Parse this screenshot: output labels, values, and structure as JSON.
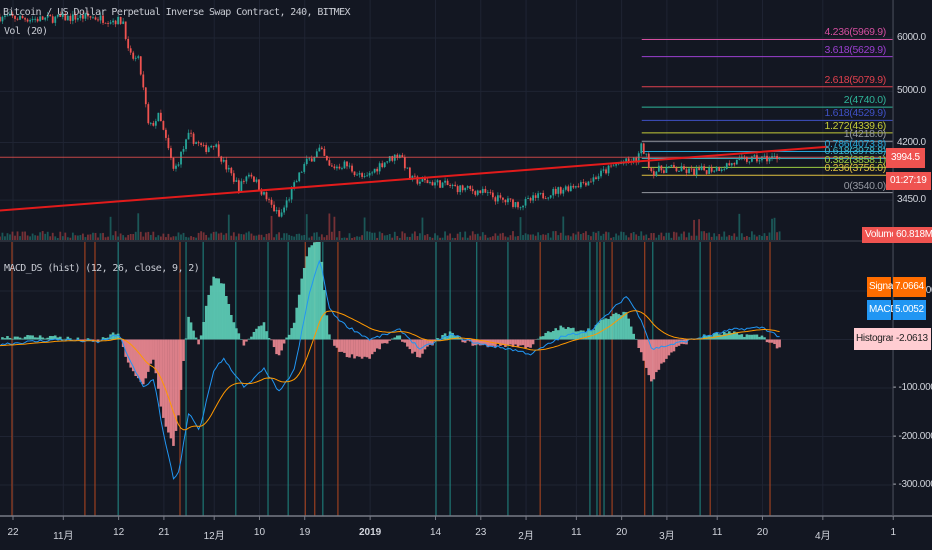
{
  "header": {
    "symbol_title": "Bitcoin / US Dollar Perpetual Inverse Swap Contract, 240, BITMEX",
    "volume_study": "Vol (20)",
    "macd_study": "MACD_DS (hist) (12, 26, close, 9, 2)"
  },
  "price_axis": {
    "ticks": [
      {
        "label": "6000.0",
        "value": 6000
      },
      {
        "label": "5000.0",
        "value": 5000
      },
      {
        "label": "4200.0",
        "value": 4200
      },
      {
        "label": "3450.0",
        "value": 3450
      }
    ],
    "last_price": "3994.5",
    "last_price_value": 3994.5,
    "countdown": "01:27:19",
    "volume_label": "Volume",
    "volume_value": "60.818M"
  },
  "macd_axis": {
    "ticks": [
      {
        "label": "100.0000",
        "value": 100
      },
      {
        "label": "0.0000",
        "value": 0
      },
      {
        "label": "-100.0000",
        "value": -100
      },
      {
        "label": "-200.0000",
        "value": -200
      },
      {
        "label": "-300.0000",
        "value": -300
      }
    ],
    "signal_label": "Signal",
    "signal_value": "7.0664",
    "macd_label": "MACD",
    "macd_value": "5.0052",
    "histogram_label": "Histogram",
    "histogram_value": "-2.0613"
  },
  "colors": {
    "background": "#131722",
    "grid": "#1f2433",
    "up": "#26a69a",
    "down": "#ef5350",
    "trendline": "#e21b1b",
    "macd_line": "#2196f3",
    "signal_line": "#ff9800",
    "hist_pos": "#5fd3bb",
    "hist_neg": "#f28b95",
    "signal_tag": "#ff6d00",
    "macd_tag": "#2196f3",
    "hist_tag": "#ffcdd2",
    "marker_teal": "#1f8a84",
    "marker_orange": "#b5471f"
  },
  "chart_data": {
    "type": "candlestick",
    "title": "Bitcoin / US Dollar Perpetual Inverse Swap Contract, 240, BITMEX",
    "x_unit": "days since 2018-10-22",
    "x_ticks": [
      {
        "label": "22",
        "day": 0
      },
      {
        "label": "11月",
        "day": 10
      },
      {
        "label": "12",
        "day": 21
      },
      {
        "label": "21",
        "day": 30
      },
      {
        "label": "12月",
        "day": 40
      },
      {
        "label": "10",
        "day": 49
      },
      {
        "label": "19",
        "day": 58
      },
      {
        "label": "2019",
        "day": 71
      },
      {
        "label": "14",
        "day": 84
      },
      {
        "label": "23",
        "day": 93
      },
      {
        "label": "2月",
        "day": 102
      },
      {
        "label": "11",
        "day": 112
      },
      {
        "label": "20",
        "day": 121
      },
      {
        "label": "3月",
        "day": 130
      },
      {
        "label": "11",
        "day": 140
      },
      {
        "label": "20",
        "day": 149
      },
      {
        "label": "4月",
        "day": 161
      },
      {
        "label": "1",
        "day": 175
      }
    ],
    "price_scale": "log",
    "price_close_keypoints": [
      [
        -3,
        6450
      ],
      [
        5,
        6400
      ],
      [
        15,
        6450
      ],
      [
        22,
        6350
      ],
      [
        23,
        5650
      ],
      [
        25,
        5550
      ],
      [
        27,
        4400
      ],
      [
        29,
        4600
      ],
      [
        32,
        3800
      ],
      [
        35,
        4300
      ],
      [
        38,
        4100
      ],
      [
        40,
        4200
      ],
      [
        42,
        3900
      ],
      [
        45,
        3600
      ],
      [
        47,
        3800
      ],
      [
        50,
        3500
      ],
      [
        53,
        3250
      ],
      [
        55,
        3500
      ],
      [
        58,
        3900
      ],
      [
        61,
        4100
      ],
      [
        63,
        3850
      ],
      [
        66,
        3900
      ],
      [
        70,
        3700
      ],
      [
        73,
        3900
      ],
      [
        77,
        4050
      ],
      [
        79,
        3700
      ],
      [
        85,
        3650
      ],
      [
        88,
        3600
      ],
      [
        93,
        3550
      ],
      [
        97,
        3450
      ],
      [
        101,
        3400
      ],
      [
        105,
        3500
      ],
      [
        110,
        3600
      ],
      [
        115,
        3700
      ],
      [
        120,
        3900
      ],
      [
        124,
        3950
      ],
      [
        125,
        4150
      ],
      [
        127,
        3800
      ],
      [
        130,
        3850
      ],
      [
        135,
        3800
      ],
      [
        140,
        3850
      ],
      [
        145,
        3950
      ],
      [
        150,
        3980
      ],
      [
        152.5,
        3994.5
      ]
    ],
    "trendline": {
      "from": [
        -2.6,
        3330
      ],
      "to": [
        162,
        4140
      ]
    },
    "fibonacci": [
      {
        "ratio": "4.236",
        "price": 5969.9,
        "label": "4.236(5969.9)",
        "color": "#d54fa0"
      },
      {
        "ratio": "3.618",
        "price": 5629.9,
        "label": "3.618(5629.9)",
        "color": "#9c3fd0"
      },
      {
        "ratio": "2.618",
        "price": 5079.9,
        "label": "2.618(5079.9)",
        "color": "#e0404e"
      },
      {
        "ratio": "2",
        "price": 4740.0,
        "label": "2(4740.0)",
        "color": "#2fb59a"
      },
      {
        "ratio": "1.618",
        "price": 4529.9,
        "label": "1.618(4529.9)",
        "color": "#3f51c5"
      },
      {
        "ratio": "1.272",
        "price": 4339.6,
        "label": "1.272(4339.6)",
        "color": "#c5cc3a"
      },
      {
        "ratio": "1",
        "price": 4218.0,
        "label": "1(4218.0)",
        "color": "#9598a1"
      },
      {
        "ratio": "0.786",
        "price": 4073.8,
        "label": "0.786(4073.8)",
        "color": "#26a6d6"
      },
      {
        "ratio": "0.618",
        "price": 3978.8,
        "label": "0.618(3978.8)",
        "color": "#3fb8c8"
      },
      {
        "ratio": "0.382",
        "price": 3858.1,
        "label": "0.382(3858.1)",
        "color": "#9ccc40"
      },
      {
        "ratio": "0.236",
        "price": 3756.0,
        "label": "0.236(3756.0)",
        "color": "#e0c040"
      },
      {
        "ratio": "0",
        "price": 3540.0,
        "label": "0(3540.0)",
        "color": "#9598a1"
      }
    ],
    "fib_start_day": 125,
    "macd_keypoints": [
      [
        -3,
        -10
      ],
      [
        9,
        0
      ],
      [
        17,
        -5
      ],
      [
        21,
        10
      ],
      [
        24,
        -60
      ],
      [
        26,
        -100
      ],
      [
        28,
        -80
      ],
      [
        30,
        -200
      ],
      [
        32,
        -290
      ],
      [
        33,
        -270
      ],
      [
        35,
        -150
      ],
      [
        37,
        -190
      ],
      [
        40,
        -60
      ],
      [
        42,
        -40
      ],
      [
        46,
        -100
      ],
      [
        50,
        -60
      ],
      [
        53,
        -110
      ],
      [
        56,
        -60
      ],
      [
        59,
        100
      ],
      [
        61,
        165
      ],
      [
        63,
        60
      ],
      [
        66,
        30
      ],
      [
        71,
        0
      ],
      [
        77,
        20
      ],
      [
        81,
        -20
      ],
      [
        87,
        10
      ],
      [
        93,
        -10
      ],
      [
        99,
        -20
      ],
      [
        103,
        -30
      ],
      [
        109,
        5
      ],
      [
        115,
        20
      ],
      [
        119,
        60
      ],
      [
        122,
        90
      ],
      [
        125,
        40
      ],
      [
        127,
        -20
      ],
      [
        131,
        -10
      ],
      [
        137,
        5
      ],
      [
        143,
        20
      ],
      [
        149,
        25
      ],
      [
        152.5,
        5
      ]
    ],
    "signal_period": 9,
    "markers_teal_days": [
      20.9,
      34.4,
      37.8,
      44.3,
      50.7,
      54.7,
      61.6,
      84.1,
      86.9,
      92.2,
      98.4,
      114.7,
      116.1,
      117.5,
      127.2,
      136.6
    ],
    "markers_orange_days": [
      -0.2,
      14.3,
      16.3,
      33.2,
      58.1,
      60,
      64.6,
      104.8,
      116.7,
      119.1,
      125.6,
      138.6,
      150.5
    ]
  }
}
